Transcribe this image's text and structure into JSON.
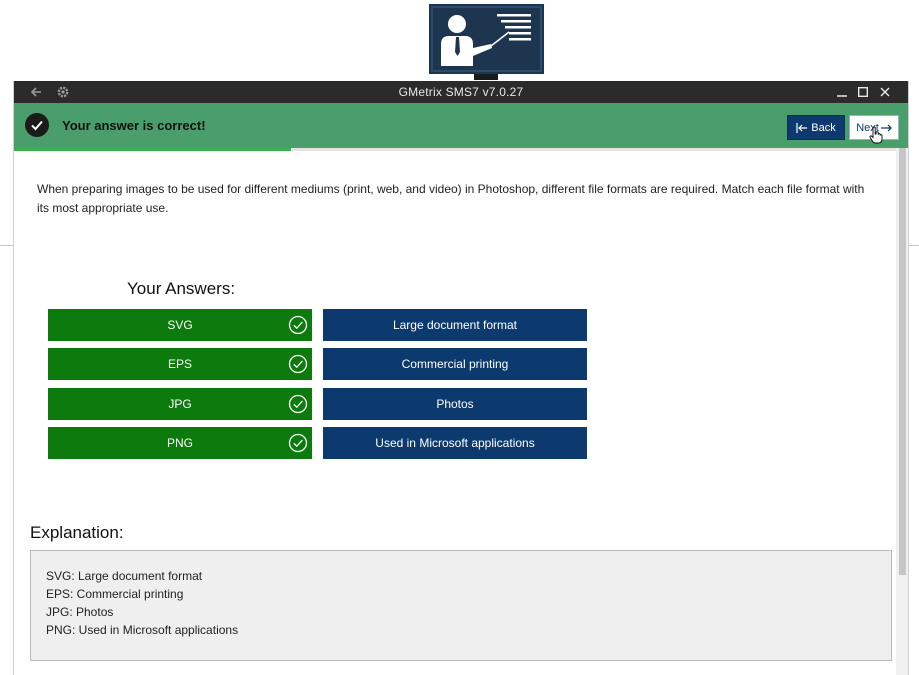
{
  "window": {
    "title": "GMetrix SMS7 v7.0.27",
    "back_icon": "back-arrow-icon",
    "settings_icon": "gear-icon",
    "controls": [
      "minimize-icon",
      "maximize-icon",
      "close-icon"
    ]
  },
  "banner": {
    "message": "Your answer is correct!",
    "status_icon": "check-circle-icon",
    "color": "#4a9e6b",
    "back_label": "Back",
    "next_label": "Next"
  },
  "progress": {
    "fraction": 0.31,
    "color": "#38b24a"
  },
  "question": {
    "text": "When preparing images to be used for different mediums (print, web, and video) in Photoshop, different file formats are required. Match each file format with its most appropriate use."
  },
  "answers": {
    "heading": "Your Answers:",
    "colors": {
      "correct": "#0d7a0d",
      "target": "#0d3a6e"
    },
    "rows": [
      {
        "format": "SVG",
        "use": "Large document format"
      },
      {
        "format": "EPS",
        "use": "Commercial printing"
      },
      {
        "format": "JPG",
        "use": "Photos"
      },
      {
        "format": "PNG",
        "use": "Used in Microsoft applications"
      }
    ]
  },
  "explanation": {
    "heading": "Explanation:",
    "lines": [
      "SVG: Large document format",
      "EPS: Commercial printing",
      "JPG: Photos",
      "PNG: Used in Microsoft applications"
    ]
  }
}
